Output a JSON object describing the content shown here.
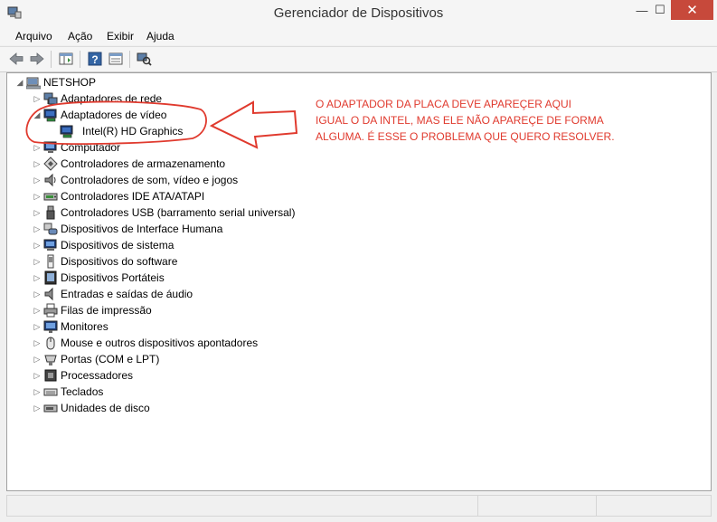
{
  "window": {
    "title": "Gerenciador de Dispositivos",
    "min": "—",
    "max": "☐",
    "close": "✕"
  },
  "menu": [
    "Arquivo",
    "Ação",
    "Exibir",
    "Ajuda"
  ],
  "tree": {
    "root": "NETSHOP",
    "items": [
      {
        "label": "Adaptadores de rede",
        "icon": "network-adapter-icon",
        "expanded": false
      },
      {
        "label": "Adaptadores de vídeo",
        "icon": "display-adapter-icon",
        "expanded": true,
        "children": [
          "Intel(R) HD Graphics"
        ]
      },
      {
        "label": "Computador",
        "icon": "computer-icon",
        "expanded": false
      },
      {
        "label": "Controladores de armazenamento",
        "icon": "storage-controller-icon",
        "expanded": false
      },
      {
        "label": "Controladores de som, vídeo e jogos",
        "icon": "speaker-icon",
        "expanded": false
      },
      {
        "label": "Controladores IDE ATA/ATAPI",
        "icon": "ide-controller-icon",
        "expanded": false
      },
      {
        "label": "Controladores USB (barramento serial universal)",
        "icon": "usb-icon",
        "expanded": false
      },
      {
        "label": "Dispositivos de Interface Humana",
        "icon": "hid-icon",
        "expanded": false
      },
      {
        "label": "Dispositivos de sistema",
        "icon": "system-devices-icon",
        "expanded": false
      },
      {
        "label": "Dispositivos do software",
        "icon": "software-device-icon",
        "expanded": false
      },
      {
        "label": "Dispositivos Portáteis",
        "icon": "portable-device-icon",
        "expanded": false
      },
      {
        "label": "Entradas e saídas de áudio",
        "icon": "audio-io-icon",
        "expanded": false
      },
      {
        "label": "Filas de impressão",
        "icon": "printer-icon",
        "expanded": false
      },
      {
        "label": "Monitores",
        "icon": "monitor-icon",
        "expanded": false
      },
      {
        "label": "Mouse e outros dispositivos apontadores",
        "icon": "mouse-icon",
        "expanded": false
      },
      {
        "label": "Portas (COM e LPT)",
        "icon": "port-icon",
        "expanded": false
      },
      {
        "label": "Processadores",
        "icon": "processor-icon",
        "expanded": false
      },
      {
        "label": "Teclados",
        "icon": "keyboard-icon",
        "expanded": false
      },
      {
        "label": "Unidades de disco",
        "icon": "disk-drive-icon",
        "expanded": false
      }
    ]
  },
  "annotation": {
    "lines": [
      "O ADAPTADOR DA PLACA DEVE APAREÇER AQUI",
      "IGUAL O DA INTEL, MAS ELE NÃO APAREÇE DE FORMA",
      "ALGUMA. É ESSE O PROBLEMA QUE QUERO RESOLVER."
    ],
    "color": "#e03a2e"
  },
  "colors": {
    "close_button": "#c7493b",
    "annotation_red": "#e03a2e"
  }
}
